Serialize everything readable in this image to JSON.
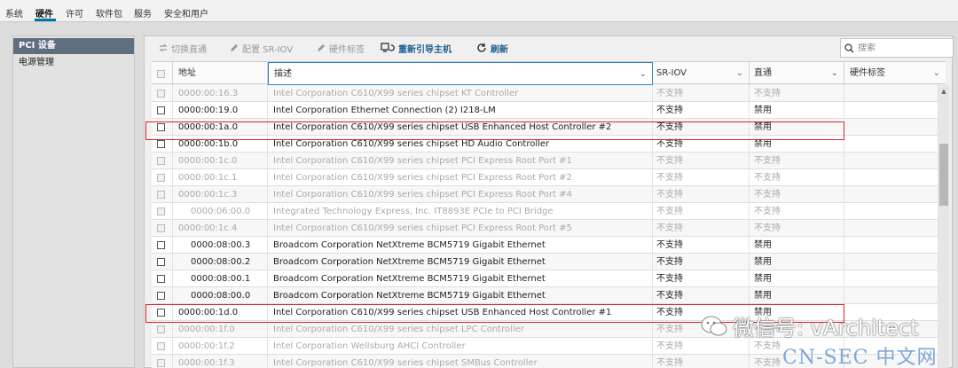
{
  "tabs": [
    "系统",
    "硬件",
    "许可",
    "软件包",
    "服务",
    "安全和用户"
  ],
  "active_tab": "硬件",
  "sidebar": {
    "items": [
      "PCI 设备",
      "电源管理"
    ]
  },
  "toolbar": {
    "toggle": "切换直通",
    "configure_sriov": "配置 SR-IOV",
    "hardware_label": "硬件标签",
    "reboot": "重新引导主机",
    "refresh": "刷新"
  },
  "search": {
    "placeholder": "搜索"
  },
  "columns": {
    "address": "地址",
    "description": "描述",
    "sriov": "SR-IOV",
    "passthrough": "直通",
    "tag": "硬件标签"
  },
  "rows": [
    {
      "address": "0000:00:16.3",
      "description": "Intel Corporation C610/X99 series chipset KT Controller",
      "sriov": "不支持",
      "passthrough": "不支持",
      "disabled": true,
      "indent": false
    },
    {
      "address": "0000:00:19.0",
      "description": "Intel Corporation Ethernet Connection (2) I218-LM",
      "sriov": "不支持",
      "passthrough": "禁用",
      "disabled": false,
      "indent": false
    },
    {
      "address": "0000:00:1a.0",
      "description": "Intel Corporation C610/X99 series chipset USB Enhanced Host Controller #2",
      "sriov": "不支持",
      "passthrough": "禁用",
      "disabled": false,
      "indent": false
    },
    {
      "address": "0000:00:1b.0",
      "description": "Intel Corporation C610/X99 series chipset HD Audio Controller",
      "sriov": "不支持",
      "passthrough": "禁用",
      "disabled": false,
      "indent": false
    },
    {
      "address": "0000:00:1c.0",
      "description": "Intel Corporation C610/X99 series chipset PCI Express Root Port #1",
      "sriov": "不支持",
      "passthrough": "不支持",
      "disabled": true,
      "indent": false
    },
    {
      "address": "0000:00:1c.1",
      "description": "Intel Corporation C610/X99 series chipset PCI Express Root Port #2",
      "sriov": "不支持",
      "passthrough": "不支持",
      "disabled": true,
      "indent": false
    },
    {
      "address": "0000:00:1c.3",
      "description": "Intel Corporation C610/X99 series chipset PCI Express Root Port #4",
      "sriov": "不支持",
      "passthrough": "不支持",
      "disabled": true,
      "indent": false
    },
    {
      "address": "0000:06:00.0",
      "description": "Integrated Technology Express, Inc. IT8893E PCIe to PCI Bridge",
      "sriov": "不支持",
      "passthrough": "不支持",
      "disabled": true,
      "indent": true
    },
    {
      "address": "0000:00:1c.4",
      "description": "Intel Corporation C610/X99 series chipset PCI Express Root Port #5",
      "sriov": "不支持",
      "passthrough": "不支持",
      "disabled": true,
      "indent": false
    },
    {
      "address": "0000:08:00.3",
      "description": "Broadcom Corporation NetXtreme BCM5719 Gigabit Ethernet",
      "sriov": "不支持",
      "passthrough": "禁用",
      "disabled": false,
      "indent": true
    },
    {
      "address": "0000:08:00.2",
      "description": "Broadcom Corporation NetXtreme BCM5719 Gigabit Ethernet",
      "sriov": "不支持",
      "passthrough": "禁用",
      "disabled": false,
      "indent": true
    },
    {
      "address": "0000:08:00.1",
      "description": "Broadcom Corporation NetXtreme BCM5719 Gigabit Ethernet",
      "sriov": "不支持",
      "passthrough": "禁用",
      "disabled": false,
      "indent": true
    },
    {
      "address": "0000:08:00.0",
      "description": "Broadcom Corporation NetXtreme BCM5719 Gigabit Ethernet",
      "sriov": "不支持",
      "passthrough": "禁用",
      "disabled": false,
      "indent": true
    },
    {
      "address": "0000:00:1d.0",
      "description": "Intel Corporation C610/X99 series chipset USB Enhanced Host Controller #1",
      "sriov": "不支持",
      "passthrough": "禁用",
      "disabled": false,
      "indent": false
    },
    {
      "address": "0000:00:1f.0",
      "description": "Intel Corporation C610/X99 series chipset LPC Controller",
      "sriov": "不支持",
      "passthrough": "不支持",
      "disabled": true,
      "indent": false
    },
    {
      "address": "0000:00:1f.2",
      "description": "Intel Corporation Wellsburg AHCI Controller",
      "sriov": "不支持",
      "passthrough": "不支持",
      "disabled": true,
      "indent": false
    },
    {
      "address": "0000:00:1f.3",
      "description": "Intel Corporation C610/X99 series chipset SMBus Controller",
      "sriov": "不支持",
      "passthrough": "不支持",
      "disabled": true,
      "indent": false
    }
  ],
  "highlighted_addresses": [
    "0000:00:1a.0",
    "0000:00:1d.0"
  ],
  "watermark": {
    "wechat": "微信号: vArchitect",
    "site": "CN-SEC 中文网"
  },
  "colors": {
    "accent": "#0072a3",
    "highlight": "#e02424",
    "selected_nav": "#5f6f80"
  }
}
